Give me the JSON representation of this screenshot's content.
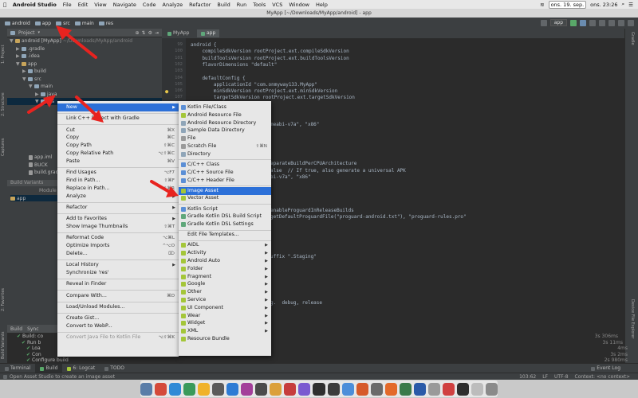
{
  "os_menubar": {
    "apple": "",
    "items": [
      "Android Studio",
      "File",
      "Edit",
      "View",
      "Navigate",
      "Code",
      "Analyze",
      "Refactor",
      "Build",
      "Run",
      "Tools",
      "VCS",
      "Window",
      "Help"
    ],
    "date_box": "ons. 19. sep.",
    "clock": "ons. 23:26"
  },
  "window": {
    "title": "MyApp [~/Downloads/MyApp/android] - app"
  },
  "breadcrumbs": [
    "android",
    "app",
    "src",
    "main",
    "res"
  ],
  "toolbar": {
    "config_selector": "app"
  },
  "left_tabs": [
    "1: Project",
    "2: Structure",
    "Captures",
    "Build Variants",
    "2: Favorites"
  ],
  "right_tabs": [
    "Gradle",
    "Device File Explorer"
  ],
  "project_panel": {
    "header": "Project",
    "tree": [
      {
        "label": "android [MyApp]",
        "suffix": " ~/Downloads/MyApp/android",
        "indent": 0,
        "arrow": "▼",
        "icon": "mod"
      },
      {
        "label": ".gradle",
        "indent": 1,
        "arrow": "▶",
        "icon": "folder"
      },
      {
        "label": ".idea",
        "indent": 1,
        "arrow": "▶",
        "icon": "folder"
      },
      {
        "label": "app",
        "indent": 1,
        "arrow": "▼",
        "icon": "mod"
      },
      {
        "label": "build",
        "indent": 2,
        "arrow": "▶",
        "icon": "folder"
      },
      {
        "label": "src",
        "indent": 2,
        "arrow": "▼",
        "icon": "folder"
      },
      {
        "label": "main",
        "indent": 3,
        "arrow": "▼",
        "icon": "folder"
      },
      {
        "label": "java",
        "indent": 4,
        "arrow": "▶",
        "icon": "folder"
      },
      {
        "label": "res",
        "indent": 4,
        "arrow": "▼",
        "icon": "folder",
        "selected": true
      }
    ],
    "lower_rows": [
      "app.iml",
      "BUCK",
      "build.gradle"
    ],
    "build_variants_label": "Build Variants",
    "module_header": "Module",
    "module_row": "app"
  },
  "editor": {
    "tabs": [
      "MyApp",
      "app"
    ],
    "lines": [
      {
        "n": "",
        "t": "android {"
      },
      {
        "n": "",
        "t": "    compileSdkVersion rootProject.ext.compileSdkVersion"
      },
      {
        "n": "",
        "t": "    buildToolsVersion rootProject.ext.buildToolsVersion"
      },
      {
        "n": "",
        "t": "    flavorDimensions \"default\""
      },
      {
        "n": "",
        "t": ""
      },
      {
        "n": "",
        "t": "    defaultConfig {"
      },
      {
        "n": "",
        "t": "        applicationId \"com.onmyway133.MyApp\""
      },
      {
        "n": "",
        "t": "        minSdkVersion rootProject.ext.minSdkVersion"
      },
      {
        "n": "",
        "t": "        targetSdkVersion rootProject.ext.targetSdkVersion"
      }
    ],
    "line_numbers": [
      "99",
      "100",
      "101",
      "102",
      "103",
      "104",
      "105",
      "106",
      "107"
    ],
    "partial_lines": [
      {
        "t": "meabi-v7a\", \"x86\"",
        "row": 12
      },
      {
        "t": "eparateBuildPerCPUArchitecture",
        "row": 18
      },
      {
        "t": "alse  // If true, also generate a universal APK",
        "row": 19
      },
      {
        "t": "bi-v7a\", \"x86\"",
        "row": 20
      },
      {
        "t": "enableProguardInReleaseBuilds",
        "row": 25
      },
      {
        "t": "getDefaultProguardFile(\"proguard-android.txt\"), \"proguard-rules.pro\"",
        "row": 26
      },
      {
        "t": "uffix \".Staging\"",
        "row": 32
      },
      {
        "t": "g.  debug, release",
        "row": 39
      }
    ]
  },
  "context_menu": [
    {
      "label": "New",
      "submenu": true,
      "highlight": true
    },
    {
      "sep": true
    },
    {
      "label": "Link C++ Project with Gradle"
    },
    {
      "sep": true
    },
    {
      "label": "Cut",
      "sc": "⌘X"
    },
    {
      "label": "Copy",
      "sc": "⌘C"
    },
    {
      "label": "Copy Path",
      "sc": "⇧⌘C"
    },
    {
      "label": "Copy Relative Path",
      "sc": "⌥⇧⌘C"
    },
    {
      "label": "Paste",
      "sc": "⌘V"
    },
    {
      "sep": true
    },
    {
      "label": "Find Usages",
      "sc": "⌥F7"
    },
    {
      "label": "Find in Path...",
      "sc": "⇧⌘F"
    },
    {
      "label": "Replace in Path...",
      "sc": "⇧⌘R"
    },
    {
      "label": "Analyze",
      "submenu": true
    },
    {
      "sep": true
    },
    {
      "label": "Refactor",
      "submenu": true
    },
    {
      "sep": true
    },
    {
      "label": "Add to Favorites",
      "submenu": true
    },
    {
      "label": "Show Image Thumbnails",
      "sc": "⇧⌘T"
    },
    {
      "sep": true
    },
    {
      "label": "Reformat Code",
      "sc": "⌥⌘L"
    },
    {
      "label": "Optimize Imports",
      "sc": "^⌥O"
    },
    {
      "label": "Delete...",
      "sc": "⌦"
    },
    {
      "sep": true
    },
    {
      "label": "Local History",
      "submenu": true
    },
    {
      "label": "Synchronize 'res'"
    },
    {
      "sep": true
    },
    {
      "label": "Reveal in Finder"
    },
    {
      "sep": true
    },
    {
      "label": "Compare With...",
      "sc": "⌘D"
    },
    {
      "sep": true
    },
    {
      "label": "Load/Unload Modules..."
    },
    {
      "sep": true
    },
    {
      "label": "Create Gist..."
    },
    {
      "label": "Convert to WebP..."
    },
    {
      "sep": true
    },
    {
      "label": "Convert Java File to Kotlin File",
      "sc": "⌥⇧⌘K",
      "disabled": true
    }
  ],
  "new_submenu": [
    {
      "label": "Kotlin File/Class",
      "icon": "#5b8fd6"
    },
    {
      "label": "Android Resource File",
      "icon": "#a4c639"
    },
    {
      "label": "Android Resource Directory",
      "icon": "#8fa5b8"
    },
    {
      "label": "Sample Data Directory",
      "icon": "#8fa5b8"
    },
    {
      "label": "File",
      "icon": "#9a9a9a"
    },
    {
      "label": "Scratch File",
      "sc": "⇧⌘N",
      "icon": "#9a9a9a"
    },
    {
      "label": "Directory",
      "icon": "#8fa5b8"
    },
    {
      "sep": true
    },
    {
      "label": "C/C++ Class",
      "icon": "#5b8fd6"
    },
    {
      "label": "C/C++ Source File",
      "icon": "#5b8fd6"
    },
    {
      "label": "C/C++ Header File",
      "icon": "#5b8fd6"
    },
    {
      "sep": true
    },
    {
      "label": "Image Asset",
      "icon": "#a4c639",
      "highlight": true
    },
    {
      "label": "Vector Asset",
      "icon": "#a4c639"
    },
    {
      "sep": true
    },
    {
      "label": "Kotlin Script",
      "icon": "#5b8fd6"
    },
    {
      "label": "Gradle Kotlin DSL Build Script",
      "icon": "#5fa77a"
    },
    {
      "label": "Gradle Kotlin DSL Settings",
      "icon": "#5fa77a"
    },
    {
      "sep": true
    },
    {
      "label": "Edit File Templates..."
    },
    {
      "sep": true
    },
    {
      "label": "AIDL",
      "submenu": true,
      "icon": "#a4c639"
    },
    {
      "label": "Activity",
      "submenu": true,
      "icon": "#a4c639"
    },
    {
      "label": "Android Auto",
      "submenu": true,
      "icon": "#a4c639"
    },
    {
      "label": "Folder",
      "submenu": true,
      "icon": "#a4c639"
    },
    {
      "label": "Fragment",
      "submenu": true,
      "icon": "#a4c639"
    },
    {
      "label": "Google",
      "submenu": true,
      "icon": "#a4c639"
    },
    {
      "label": "Other",
      "submenu": true,
      "icon": "#a4c639"
    },
    {
      "label": "Service",
      "submenu": true,
      "icon": "#a4c639"
    },
    {
      "label": "UI Component",
      "submenu": true,
      "icon": "#a4c639"
    },
    {
      "label": "Wear",
      "submenu": true,
      "icon": "#a4c639"
    },
    {
      "label": "Widget",
      "submenu": true,
      "icon": "#a4c639"
    },
    {
      "label": "XML",
      "submenu": true,
      "icon": "#a4c639"
    },
    {
      "label": "Resource Bundle",
      "icon": "#a4c639"
    }
  ],
  "build_panel": {
    "header_tabs": [
      "Build",
      "Sync"
    ],
    "rows": [
      {
        "label": "Build: co",
        "time": "3s 306ms"
      },
      {
        "label": "Run b",
        "time": "3s 11ms"
      },
      {
        "label": "Loa",
        "time": "4ms"
      },
      {
        "label": "Con",
        "time": "3s 2ms"
      },
      {
        "label": "Configure build",
        "time": "2s 980ms"
      }
    ]
  },
  "bottom_tabs": [
    "Terminal",
    "Build",
    "6: Logcat",
    "TODO"
  ],
  "event_log": "Event Log",
  "status": {
    "message": "Open Asset Studio to create an image asset",
    "position": "103:62",
    "line_sep": "LF",
    "encoding": "UTF-8",
    "context": "Context: <no context>"
  },
  "dock_colors": [
    "#5a7da8",
    "#d44a3a",
    "#2f8ad6",
    "#3a9a5a",
    "#f0b22a",
    "#5b5b5b",
    "#2d7bd4",
    "#a33f9a",
    "#4b4b4b",
    "#dba03a",
    "#c63d3d",
    "#7a5ad0",
    "#2f2f2f",
    "#3b3b3b",
    "#4c8ed9",
    "#d65a2a",
    "#6a6a6a",
    "#e36a2a",
    "#3a7a4a",
    "#2a5aa8",
    "#9a9a9a",
    "#d04040",
    "#2e2e2e",
    "#bcbcbc",
    "#8a8a8a"
  ],
  "accent": "#2c70d8"
}
